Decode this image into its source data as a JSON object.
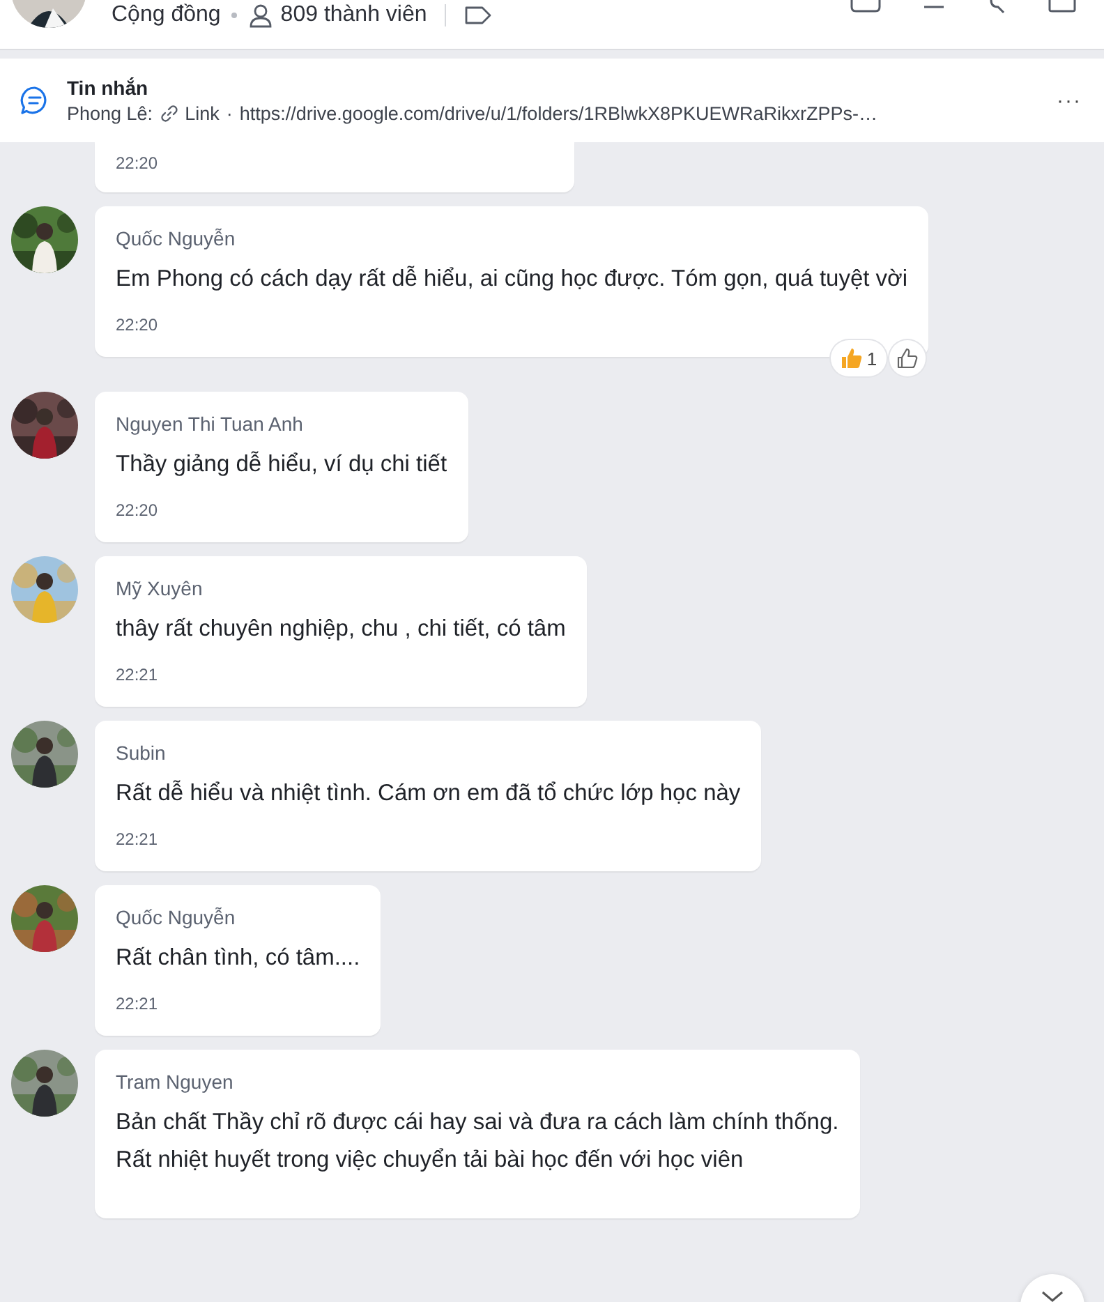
{
  "header": {
    "subtitle": "Cộng đồng",
    "members": "809 thành viên"
  },
  "pinned": {
    "title": "Tin nhắn",
    "sender": "Phong Lê:",
    "link_label": "Link",
    "separator": "·",
    "url": "https://drive.google.com/drive/u/1/folders/1RBlwkX8PKUEWRaRikxrZPPs-…",
    "more": "···"
  },
  "messages": [
    {
      "kind": "partial",
      "time": "22:20"
    },
    {
      "kind": "message",
      "author": "Quốc Nguyễn",
      "text": "Em Phong có cách dạy rất dễ hiểu, ai cũng học được. Tóm gọn, quá tuyệt vời",
      "time": "22:20",
      "reaction_count": "1"
    },
    {
      "kind": "message",
      "author": "Nguyen Thi Tuan Anh",
      "text": "Thầy giảng dễ hiểu, ví dụ chi tiết",
      "time": "22:20"
    },
    {
      "kind": "message",
      "author": "Mỹ Xuyên",
      "text": "thây rất chuyên nghiệp, chu , chi tiết, có tâm",
      "time": "22:21"
    },
    {
      "kind": "message",
      "author": "Subin",
      "text": "Rất dễ hiểu và nhiệt tình. Cám ơn em đã tổ chức lớp học này",
      "time": "22:21"
    },
    {
      "kind": "message",
      "author": "Quốc Nguyễn",
      "text": "Rất chân tình, có tâm....",
      "time": "22:21"
    },
    {
      "kind": "message",
      "author": "Tram Nguyen",
      "text": "Bản chất Thầy chỉ rõ được cái hay sai và đưa ra cách làm chính thống.\nRất nhiệt huyết trong việc chuyển tải bài học đến với học viên"
    }
  ]
}
